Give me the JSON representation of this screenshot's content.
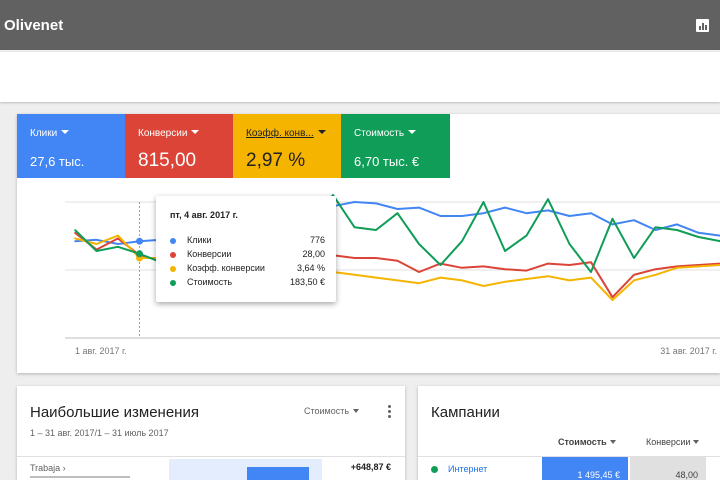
{
  "app": {
    "title": "Olivenet",
    "report_icon": "bar-chart-icon"
  },
  "metrics": [
    {
      "label": "Клики",
      "value": "27,6 тыс.",
      "color": "#4285f4"
    },
    {
      "label": "Конверсии",
      "value": "815,00",
      "color": "#db4437"
    },
    {
      "label": "Коэфф. конв...",
      "value": "2,97 %",
      "color": "#f4b400"
    },
    {
      "label": "Стоимость",
      "value": "6,70 тыс. €",
      "color": "#0f9d58"
    }
  ],
  "chart": {
    "x_start_label": "1 авг. 2017 г.",
    "x_end_label": "31 авг. 2017 г."
  },
  "chart_data": {
    "type": "line",
    "x": [
      "2017-08-01",
      "2017-08-02",
      "2017-08-03",
      "2017-08-04",
      "2017-08-05",
      "2017-08-06",
      "2017-08-07",
      "2017-08-08",
      "2017-08-09",
      "2017-08-10",
      "2017-08-11",
      "2017-08-12",
      "2017-08-13",
      "2017-08-14",
      "2017-08-15",
      "2017-08-16",
      "2017-08-17",
      "2017-08-18",
      "2017-08-19",
      "2017-08-20",
      "2017-08-21",
      "2017-08-22",
      "2017-08-23",
      "2017-08-24",
      "2017-08-25",
      "2017-08-26",
      "2017-08-27",
      "2017-08-28",
      "2017-08-29",
      "2017-08-30",
      "2017-08-31"
    ],
    "series": [
      {
        "name": "Клики",
        "color": "#4285f4",
        "values": [
          0.62,
          0.63,
          0.6,
          0.62,
          0.63,
          0.62,
          0.64,
          0.66,
          0.68,
          0.64,
          0.62,
          0.79,
          0.87,
          0.9,
          0.89,
          0.85,
          0.86,
          0.8,
          0.8,
          0.82,
          0.86,
          0.82,
          0.84,
          0.8,
          0.82,
          0.74,
          0.77,
          0.7,
          0.74,
          0.68,
          0.66
        ]
      },
      {
        "name": "Конверсии",
        "color": "#db4437",
        "values": [
          0.68,
          0.56,
          0.64,
          0.52,
          0.48,
          0.5,
          0.47,
          0.46,
          0.44,
          0.43,
          0.41,
          0.46,
          0.52,
          0.5,
          0.5,
          0.48,
          0.4,
          0.46,
          0.43,
          0.44,
          0.42,
          0.41,
          0.46,
          0.45,
          0.47,
          0.22,
          0.38,
          0.42,
          0.44,
          0.45,
          0.46
        ]
      },
      {
        "name": "Коэфф. конверсии",
        "color": "#f4b400",
        "values": [
          0.64,
          0.6,
          0.66,
          0.5,
          0.5,
          0.44,
          0.4,
          0.38,
          0.4,
          0.36,
          0.34,
          0.36,
          0.4,
          0.38,
          0.36,
          0.34,
          0.32,
          0.36,
          0.34,
          0.3,
          0.33,
          0.35,
          0.37,
          0.34,
          0.36,
          0.2,
          0.34,
          0.38,
          0.43,
          0.44,
          0.45
        ]
      },
      {
        "name": "Стоимость",
        "color": "#0f9d58",
        "values": [
          0.7,
          0.55,
          0.58,
          0.53,
          0.47,
          0.55,
          0.58,
          0.6,
          0.58,
          0.56,
          0.52,
          0.78,
          0.95,
          0.72,
          0.7,
          0.82,
          0.6,
          0.45,
          0.62,
          0.9,
          0.55,
          0.66,
          0.92,
          0.6,
          0.4,
          0.78,
          0.5,
          0.72,
          0.7,
          0.65,
          0.62
        ]
      }
    ]
  },
  "tooltip": {
    "title": "пт, 4 авг. 2017 г.",
    "rows": [
      {
        "name": "Клики",
        "value": "776",
        "color": "#4285f4"
      },
      {
        "name": "Конверсии",
        "value": "28,00",
        "color": "#db4437"
      },
      {
        "name": "Коэфф. конверсии",
        "value": "3,64 %",
        "color": "#f4b400"
      },
      {
        "name": "Стоимость",
        "value": "183,50 €",
        "color": "#0f9d58"
      }
    ]
  },
  "changes": {
    "title": "Наибольшие изменения",
    "subtitle": "1 – 31 авг. 2017/1 – 31 июль 2017",
    "metric": "Стоимость",
    "menu_icon": "more-vert-icon",
    "row_label": "Trabaja ›",
    "row_value": "+648,87 €"
  },
  "campaigns": {
    "title": "Кампании",
    "col_cost": "Стоимость",
    "col_conv": "Конверсии",
    "row_name": "Интернет",
    "row_cost": "1 495,45 €",
    "row_conv": "48,00"
  }
}
